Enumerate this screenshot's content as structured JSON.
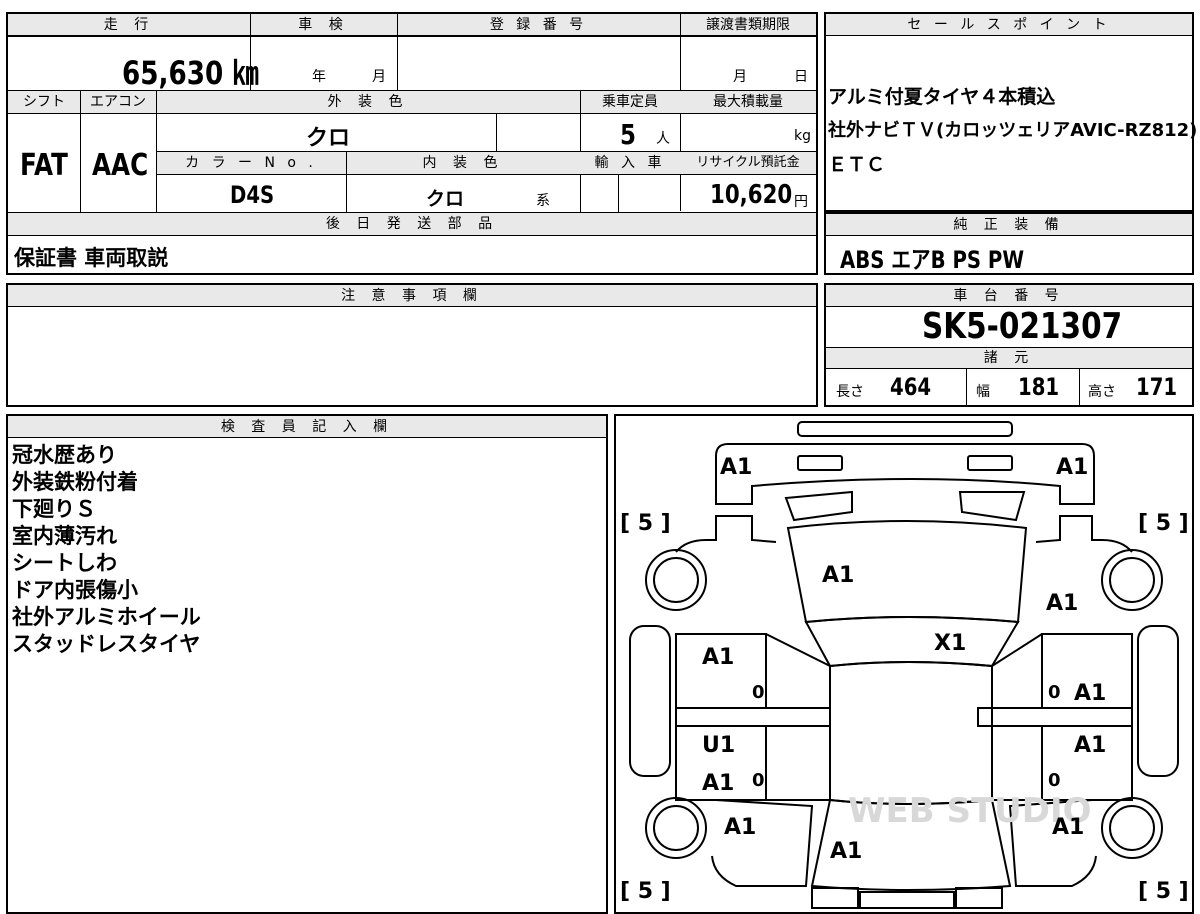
{
  "spec": {
    "mileage_label": "走 行",
    "mileage_value": "65,630 ㎞",
    "inspection_label": "車 検",
    "inspection_year": "年",
    "inspection_month": "月",
    "registration_label": "登 録 番 号",
    "transfer_deadline_label": "譲渡書類期限",
    "transfer_month": "月",
    "transfer_day": "日",
    "shift_label": "シフト",
    "shift_value": "FAT",
    "ac_label": "エアコン",
    "ac_value": "AAC",
    "exterior_color_label": "外 装 色",
    "exterior_color_value": "クロ",
    "capacity_label": "乗車定員",
    "capacity_value": "5",
    "capacity_unit": "人",
    "max_load_label": "最大積載量",
    "max_load_unit": "kg",
    "color_no_label": "カ ラ ー N o .",
    "color_no_value": "D4S",
    "interior_color_label": "内 装 色",
    "interior_color_value": "クロ",
    "interior_color_suffix": "系",
    "import_label": "輸 入 車",
    "recycle_label": "リサイクル預託金",
    "recycle_value": "10,620",
    "recycle_unit": "円",
    "later_parts_label": "後 日 発 送 部 品",
    "later_parts_value": "保証書 車両取説"
  },
  "sales_points": {
    "label": "セ ー ル ス ポ イ ン ト",
    "lines": [
      "アルミ付夏タイヤ４本積込",
      "社外ナビＴＶ(カロッツェリアAVIC-RZ812)",
      "ＥＴＣ"
    ]
  },
  "equipment": {
    "label": "純 正 装 備",
    "value": "ABS エアB PS PW"
  },
  "notes": {
    "label": "注 意 事 項 欄"
  },
  "chassis": {
    "label": "車 台 番 号",
    "value": "SK5-021307",
    "dims_label": "諸 元",
    "length_label": "長さ",
    "length_value": "464",
    "width_label": "幅",
    "width_value": "181",
    "height_label": "高さ",
    "height_value": "171"
  },
  "inspector": {
    "label": "検 査 員 記 入 欄",
    "lines": [
      "冠水歴あり",
      "外装鉄粉付着",
      "下廻りＳ",
      "室内薄汚れ",
      "シートしわ",
      "ドア内張傷小",
      "社外アルミホイール",
      "スタッドレスタイヤ"
    ]
  },
  "diagram": {
    "tread_fl": "[ 5 ]",
    "tread_fr": "[ 5 ]",
    "tread_rl": "[ 5 ]",
    "tread_rr": "[ 5 ]",
    "bumper_left": "A1",
    "bumper_right": "A1",
    "hood": "A1",
    "fender_right": "A1",
    "windshield": "X1",
    "front_door_left": "A1",
    "front_door_right": "A1",
    "rear_door_left_1": "U1",
    "rear_door_left_2": "A1",
    "rear_door_right": "A1",
    "rear_fender_left": "A1",
    "rear_fender_right": "A1",
    "rear_glass": "A1",
    "zero": "0",
    "watermark": "WEB STUDIO"
  }
}
